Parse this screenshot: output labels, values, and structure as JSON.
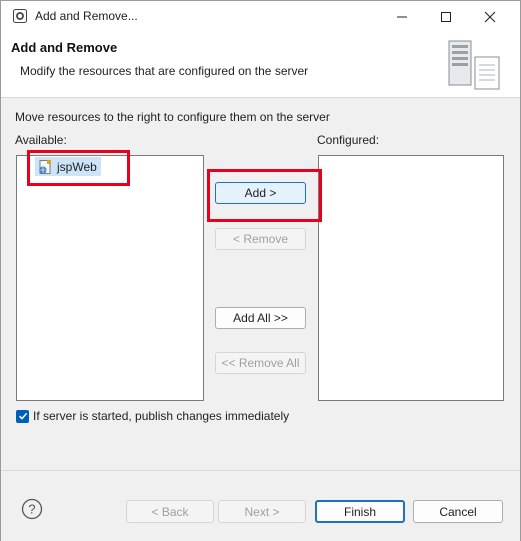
{
  "window": {
    "title": "Add and Remove..."
  },
  "header": {
    "title": "Add and Remove",
    "subtitle": "Modify the resources that are configured on the server"
  },
  "instruction": "Move resources to the right to configure them on the server",
  "available": {
    "label": "Available:",
    "items": [
      {
        "label": "jspWeb",
        "selected": true
      }
    ]
  },
  "configured": {
    "label": "Configured:",
    "items": []
  },
  "buttons": {
    "add": "Add >",
    "remove": "< Remove",
    "add_all": "Add All >>",
    "remove_all": "<< Remove All"
  },
  "publish_checkbox": {
    "label": "If server is started, publish changes immediately",
    "checked": true
  },
  "footer": {
    "back": "< Back",
    "next": "Next >",
    "finish": "Finish",
    "cancel": "Cancel"
  },
  "colors": {
    "accent": "#005fb8",
    "highlight": "#e8001c",
    "selection": "#cce4f7"
  }
}
